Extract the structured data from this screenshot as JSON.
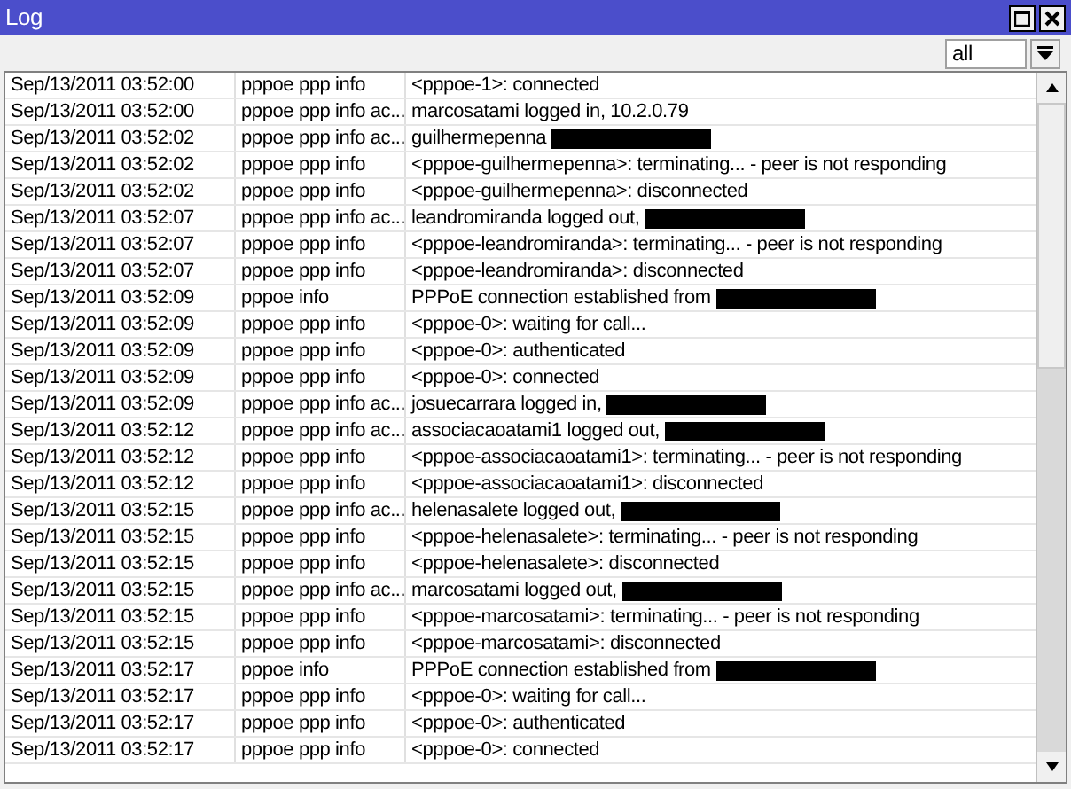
{
  "window": {
    "title": "Log"
  },
  "filter": {
    "value": "all"
  },
  "rows": [
    {
      "time": "Sep/13/2011 03:52:00",
      "topics": "pppoe ppp info",
      "message": "<pppoe-1>: connected",
      "redacted": false
    },
    {
      "time": "Sep/13/2011 03:52:00",
      "topics": "pppoe ppp info ac...",
      "message": "marcosatami logged in, 10.2.0.79",
      "redacted": false
    },
    {
      "time": "Sep/13/2011 03:52:02",
      "topics": "pppoe ppp info ac...",
      "message": "guilhermepenna",
      "redacted": true
    },
    {
      "time": "Sep/13/2011 03:52:02",
      "topics": "pppoe ppp info",
      "message": "<pppoe-guilhermepenna>: terminating... - peer is not responding",
      "redacted": false
    },
    {
      "time": "Sep/13/2011 03:52:02",
      "topics": "pppoe ppp info",
      "message": "<pppoe-guilhermepenna>: disconnected",
      "redacted": false
    },
    {
      "time": "Sep/13/2011 03:52:07",
      "topics": "pppoe ppp info ac...",
      "message": "leandromiranda logged out,",
      "redacted": true
    },
    {
      "time": "Sep/13/2011 03:52:07",
      "topics": "pppoe ppp info",
      "message": "<pppoe-leandromiranda>: terminating... - peer is not responding",
      "redacted": false
    },
    {
      "time": "Sep/13/2011 03:52:07",
      "topics": "pppoe ppp info",
      "message": "<pppoe-leandromiranda>: disconnected",
      "redacted": false
    },
    {
      "time": "Sep/13/2011 03:52:09",
      "topics": "pppoe info",
      "message": "PPPoE connection established from",
      "redacted": true
    },
    {
      "time": "Sep/13/2011 03:52:09",
      "topics": "pppoe ppp info",
      "message": "<pppoe-0>: waiting for call...",
      "redacted": false
    },
    {
      "time": "Sep/13/2011 03:52:09",
      "topics": "pppoe ppp info",
      "message": "<pppoe-0>: authenticated",
      "redacted": false
    },
    {
      "time": "Sep/13/2011 03:52:09",
      "topics": "pppoe ppp info",
      "message": "<pppoe-0>: connected",
      "redacted": false
    },
    {
      "time": "Sep/13/2011 03:52:09",
      "topics": "pppoe ppp info ac...",
      "message": "josuecarrara logged in,",
      "redacted": true
    },
    {
      "time": "Sep/13/2011 03:52:12",
      "topics": "pppoe ppp info ac...",
      "message": "associacaoatami1 logged out,",
      "redacted": true
    },
    {
      "time": "Sep/13/2011 03:52:12",
      "topics": "pppoe ppp info",
      "message": "<pppoe-associacaoatami1>: terminating... - peer is not responding",
      "redacted": false
    },
    {
      "time": "Sep/13/2011 03:52:12",
      "topics": "pppoe ppp info",
      "message": "<pppoe-associacaoatami1>: disconnected",
      "redacted": false
    },
    {
      "time": "Sep/13/2011 03:52:15",
      "topics": "pppoe ppp info ac...",
      "message": "helenasalete logged out,",
      "redacted": true
    },
    {
      "time": "Sep/13/2011 03:52:15",
      "topics": "pppoe ppp info",
      "message": "<pppoe-helenasalete>: terminating... - peer is not responding",
      "redacted": false
    },
    {
      "time": "Sep/13/2011 03:52:15",
      "topics": "pppoe ppp info",
      "message": "<pppoe-helenasalete>: disconnected",
      "redacted": false
    },
    {
      "time": "Sep/13/2011 03:52:15",
      "topics": "pppoe ppp info ac...",
      "message": "marcosatami logged out,",
      "redacted": true
    },
    {
      "time": "Sep/13/2011 03:52:15",
      "topics": "pppoe ppp info",
      "message": "<pppoe-marcosatami>: terminating... - peer is not responding",
      "redacted": false
    },
    {
      "time": "Sep/13/2011 03:52:15",
      "topics": "pppoe ppp info",
      "message": "<pppoe-marcosatami>: disconnected",
      "redacted": false
    },
    {
      "time": "Sep/13/2011 03:52:17",
      "topics": "pppoe info",
      "message": "PPPoE connection established from",
      "redacted": true
    },
    {
      "time": "Sep/13/2011 03:52:17",
      "topics": "pppoe ppp info",
      "message": "<pppoe-0>: waiting for call...",
      "redacted": false
    },
    {
      "time": "Sep/13/2011 03:52:17",
      "topics": "pppoe ppp info",
      "message": "<pppoe-0>: authenticated",
      "redacted": false
    },
    {
      "time": "Sep/13/2011 03:52:17",
      "topics": "pppoe ppp info",
      "message": "<pppoe-0>: connected",
      "redacted": false
    }
  ]
}
